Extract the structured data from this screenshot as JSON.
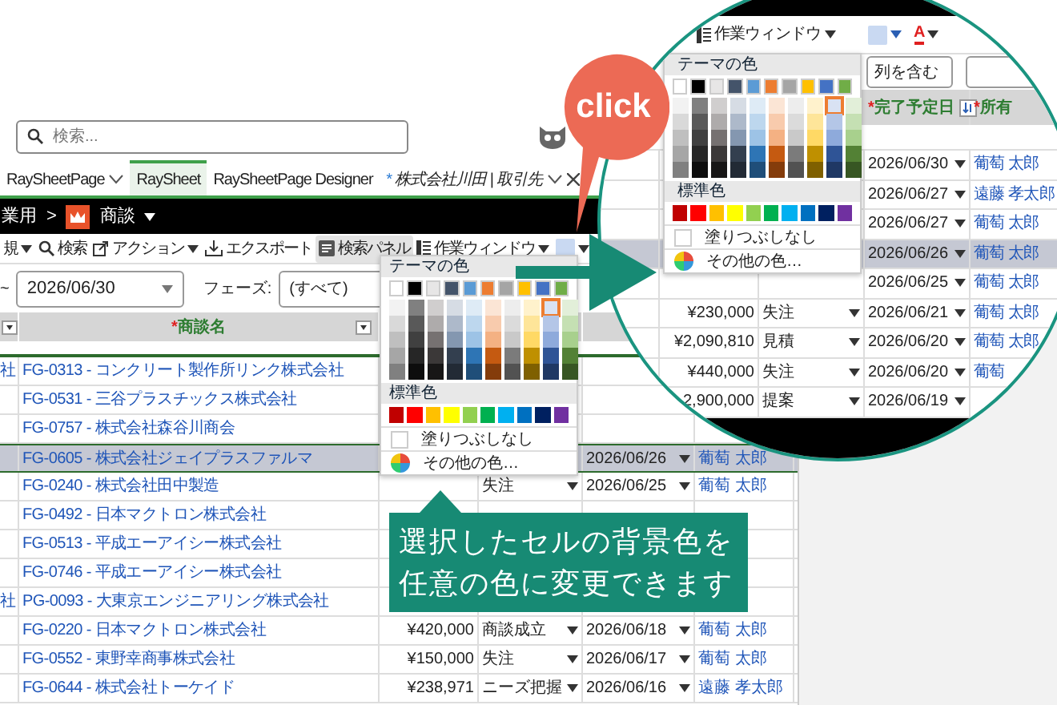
{
  "search": {
    "placeholder": "検索..."
  },
  "tabs": [
    {
      "label": "RaySheetPage",
      "selected": false,
      "menu": true
    },
    {
      "label": "RaySheet",
      "selected": true
    },
    {
      "label": "RaySheetPage Designer",
      "selected": false
    },
    {
      "label": "株式会社川田 | 取引先",
      "marker": "*",
      "selected": false,
      "menu": true,
      "closable": true
    }
  ],
  "breadcrumb": {
    "parent": "業用",
    "separator": ">",
    "app": "商談"
  },
  "toolbar": [
    {
      "label": "規",
      "caret": true,
      "pressed": false
    },
    {
      "label": "検索",
      "kind": "search",
      "pressed": false
    },
    {
      "label": "アクション",
      "kind": "action",
      "caret": true,
      "pressed": false
    },
    {
      "label": "エクスポート",
      "kind": "export",
      "pressed": false
    },
    {
      "label": "検索パネル",
      "kind": "panel",
      "pressed": true
    },
    {
      "label": "作業ウィンドウ",
      "kind": "window",
      "caret": true,
      "pressed": false
    },
    {
      "kind": "fill",
      "caret": true,
      "pressed": false
    }
  ],
  "filter": {
    "prefix": "~",
    "date": "2026/06/30",
    "phase_label": "フェーズ:",
    "phase_value": "(すべて)"
  },
  "table": {
    "columns": [
      {
        "filter": true
      },
      {
        "mark": "*",
        "label": "商談名",
        "filter": true
      }
    ],
    "rows": [
      {
        "column_1": "社",
        "name": "FG-0313 - コンクリート製作所リンク株式会社",
        "selected": false
      },
      {
        "name": "FG-0531 - 三谷プラスチックス株式会社",
        "selected": false
      },
      {
        "name": "FG-0757 - 株式会社森谷川商会",
        "selected": false
      },
      {
        "name": "FG-0605 - 株式会社ジェイプラスファルマ",
        "date": "2026/06/26",
        "owner": "葡萄 太郎",
        "selected": true
      },
      {
        "name": "FG-0240 - 株式会社田中製造",
        "phase": "失注",
        "date": "2026/06/25",
        "owner": "葡萄 太郎",
        "selected": false
      },
      {
        "name": "FG-0492 - 日本マクトロン株式会社",
        "selected": false
      },
      {
        "name": "FG-0513 - 平成エーアイシー株式会社",
        "selected": false
      },
      {
        "name": "FG-0746 - 平成エーアイシー株式会社",
        "selected": false
      },
      {
        "column_1": "社",
        "name": "PG-0093 - 大東京エンジニアリング株式会社",
        "selected": false
      },
      {
        "name": "FG-0220 - 日本マクトロン株式会社",
        "amount": "¥420,000",
        "phase": "商談成立",
        "date": "2026/06/18",
        "owner": "葡萄 太郎",
        "selected": false
      },
      {
        "name": "FG-0552 - 東野幸商事株式会社",
        "amount": "¥150,000",
        "phase": "失注",
        "date": "2026/06/17",
        "owner": "葡萄 太郎",
        "selected": false
      },
      {
        "name": "FG-0644 - 株式会社トーケイド",
        "amount": "¥238,971",
        "phase": "ニーズ把握",
        "date": "2026/06/16",
        "owner": "遠藤 孝太郎",
        "selected": false
      }
    ]
  },
  "popup": {
    "theme_title": "テーマの色",
    "theme_colors": [
      {
        "color": "#ffffff",
        "shades": [
          {
            "color": "#f2f2f2",
            "selected": false
          },
          {
            "color": "#d9d9d9",
            "selected": false
          },
          {
            "color": "#bfbfbf",
            "selected": false
          },
          {
            "color": "#a6a6a6",
            "selected": false
          },
          {
            "color": "#808080",
            "selected": false
          }
        ]
      },
      {
        "color": "#000000",
        "shades": [
          {
            "color": "#808080",
            "selected": false
          },
          {
            "color": "#595959",
            "selected": false
          },
          {
            "color": "#404040",
            "selected": false
          },
          {
            "color": "#262626",
            "selected": false
          },
          {
            "color": "#0d0d0d",
            "selected": false
          }
        ]
      },
      {
        "color": "#e7e6e6",
        "shades": [
          {
            "color": "#d0cece",
            "selected": false
          },
          {
            "color": "#aeabab",
            "selected": false
          },
          {
            "color": "#767171",
            "selected": false
          },
          {
            "color": "#3b3838",
            "selected": false
          },
          {
            "color": "#171616",
            "selected": false
          }
        ]
      },
      {
        "color": "#44546a",
        "shades": [
          {
            "color": "#d6dce4",
            "selected": false
          },
          {
            "color": "#adb9ca",
            "selected": false
          },
          {
            "color": "#8497b0",
            "selected": false
          },
          {
            "color": "#333f4f",
            "selected": false
          },
          {
            "color": "#222a35",
            "selected": false
          }
        ]
      },
      {
        "color": "#5b9bd5",
        "shades": [
          {
            "color": "#deebf6",
            "selected": false
          },
          {
            "color": "#bdd7ee",
            "selected": false
          },
          {
            "color": "#9dc3e6",
            "selected": false
          },
          {
            "color": "#2e75b5",
            "selected": false
          },
          {
            "color": "#1f4e79",
            "selected": false
          }
        ]
      },
      {
        "color": "#ed7d31",
        "shades": [
          {
            "color": "#fbe5d5",
            "selected": false
          },
          {
            "color": "#f8cbad",
            "selected": false
          },
          {
            "color": "#f4b183",
            "selected": false
          },
          {
            "color": "#c55a11",
            "selected": false
          },
          {
            "color": "#843c0b",
            "selected": false
          }
        ]
      },
      {
        "color": "#a5a5a5",
        "shades": [
          {
            "color": "#ededed",
            "selected": false
          },
          {
            "color": "#dbdbdb",
            "selected": false
          },
          {
            "color": "#c9c9c9",
            "selected": false
          },
          {
            "color": "#7b7b7b",
            "selected": false
          },
          {
            "color": "#525252",
            "selected": false
          }
        ]
      },
      {
        "color": "#ffc000",
        "shades": [
          {
            "color": "#fff2cc",
            "selected": false
          },
          {
            "color": "#fee599",
            "selected": false
          },
          {
            "color": "#ffd965",
            "selected": false
          },
          {
            "color": "#bf9000",
            "selected": false
          },
          {
            "color": "#7f6000",
            "selected": false
          }
        ]
      },
      {
        "color": "#4472c4",
        "shades": [
          {
            "color": "#d9e2f3",
            "selected": true
          },
          {
            "color": "#b4c6e7",
            "selected": false
          },
          {
            "color": "#8eaadb",
            "selected": false
          },
          {
            "color": "#2f5496",
            "selected": false
          },
          {
            "color": "#1f3864",
            "selected": false
          }
        ]
      },
      {
        "color": "#70ad47",
        "shades": [
          {
            "color": "#e2efd9",
            "selected": false
          },
          {
            "color": "#c5e0b3",
            "selected": false
          },
          {
            "color": "#a8d08d",
            "selected": false
          },
          {
            "color": "#538135",
            "selected": false
          },
          {
            "color": "#375623",
            "selected": false
          }
        ]
      }
    ],
    "standard_title": "標準色",
    "standard_colors": [
      {
        "color": "#c00000"
      },
      {
        "color": "#ff0000"
      },
      {
        "color": "#ffc000"
      },
      {
        "color": "#ffff00"
      },
      {
        "color": "#92d050"
      },
      {
        "color": "#00b050"
      },
      {
        "color": "#00b0f0"
      },
      {
        "color": "#0070c0"
      },
      {
        "color": "#002060"
      },
      {
        "color": "#7030a0"
      }
    ],
    "no_fill": "塗りつぶしなし",
    "more": "その他の色…"
  },
  "magnifier": {
    "toolbar": [
      {
        "label": "作業ウィンドウ",
        "kind": "window",
        "caret": true
      },
      {
        "kind": "fill",
        "caret": true
      },
      {
        "kind": "font-color",
        "glyph": "A",
        "caret": true
      }
    ],
    "field": "列を含む",
    "popup": {
      "theme_title": "テーマの色",
      "standard_title": "標準色",
      "no_fill": "塗りつぶしなし",
      "more": "その他の色…"
    },
    "columns": [
      {
        "mark": "*",
        "label": "完了予定日",
        "sort": true
      },
      {
        "mark": "*",
        "label": "所有"
      }
    ],
    "rows": [
      {
        "date": "2026/06/30",
        "owner": "葡萄 太郎",
        "selected": false
      },
      {
        "date": "2026/06/27",
        "owner": "遠藤 孝太郎",
        "selected": false
      },
      {
        "date": "2026/06/27",
        "owner": "葡萄 太郎",
        "selected": false
      },
      {
        "date": "2026/06/26",
        "owner": "葡萄 太郎",
        "selected": true
      },
      {
        "date": "2026/06/25",
        "owner": "葡萄 太郎",
        "selected": false
      },
      {
        "amount": "¥230,000",
        "phase": "失注",
        "date": "2026/06/21",
        "owner": "葡萄 太郎",
        "selected": false
      },
      {
        "amount": "¥2,090,810",
        "phase": "見積",
        "date": "2026/06/20",
        "owner": "葡萄 太郎",
        "selected": false
      },
      {
        "amount": "¥440,000",
        "phase": "失注",
        "date": "2026/06/20",
        "owner": "葡萄",
        "selected": false
      },
      {
        "amount": "2,900,000",
        "phase": "提案",
        "date": "2026/06/19",
        "selected": false
      }
    ]
  },
  "click_bubble": {
    "text": "click"
  },
  "callout": {
    "lines": [
      "選択したセルの背景色を",
      "任意の色に変更できます"
    ]
  }
}
